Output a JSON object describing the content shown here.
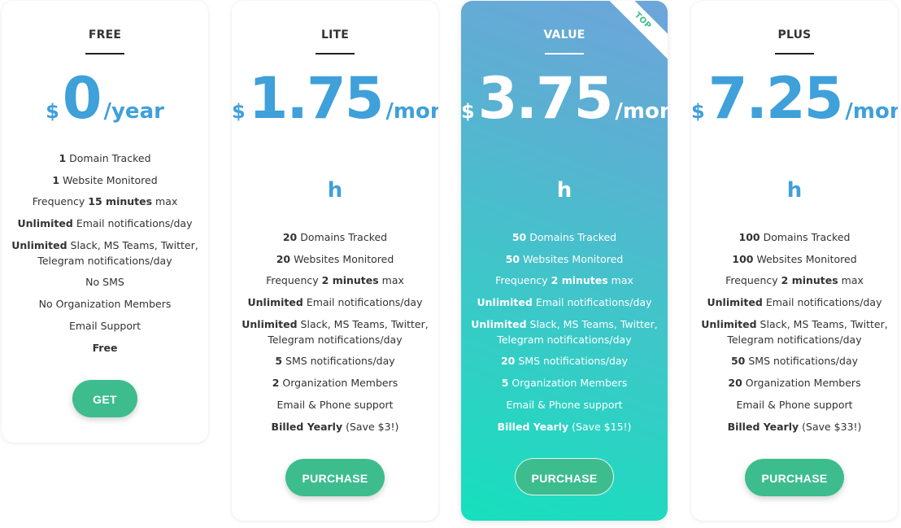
{
  "plans": [
    {
      "name": "FREE",
      "currency": "$",
      "amount": "0",
      "period": "/year",
      "period_wrap": "",
      "features": [
        {
          "bold": "1",
          "text": " Domain Tracked"
        },
        {
          "bold": "1",
          "text": " Website Monitored"
        },
        {
          "pre": "Frequency ",
          "bold": "15 minutes",
          "text": " max"
        },
        {
          "bold": "Unlimited",
          "text": " Email notifications/day"
        },
        {
          "bold": "Unlimited",
          "text": " Slack, MS Teams, Twitter, Telegram notifications/day"
        },
        {
          "bold": "",
          "text": "No SMS"
        },
        {
          "bold": "",
          "text": "No Organization Members"
        },
        {
          "bold": "",
          "text": "Email Support"
        },
        {
          "bold": "Free",
          "text": ""
        }
      ],
      "button": "GET"
    },
    {
      "name": "LITE",
      "currency": "$",
      "amount": "1.75",
      "period": "/mont",
      "period_wrap": "h",
      "features": [
        {
          "bold": "20",
          "text": " Domains Tracked"
        },
        {
          "bold": "20",
          "text": " Websites Monitored"
        },
        {
          "pre": "Frequency ",
          "bold": "2 minutes",
          "text": " max"
        },
        {
          "bold": "Unlimited",
          "text": " Email notifications/day"
        },
        {
          "bold": "Unlimited",
          "text": " Slack, MS Teams, Twitter, Telegram notifications/day"
        },
        {
          "bold": "5",
          "text": " SMS notifications/day"
        },
        {
          "bold": "2",
          "text": " Organization Members"
        },
        {
          "bold": "",
          "text": "Email & Phone support"
        },
        {
          "bold": "Billed Yearly",
          "text": " (Save $3!)"
        }
      ],
      "button": "PURCHASE"
    },
    {
      "name": "VALUE",
      "currency": "$",
      "amount": "3.75",
      "period": "/mont",
      "period_wrap": "h",
      "ribbon": "TOP",
      "features": [
        {
          "bold": "50",
          "text": " Domains Tracked"
        },
        {
          "bold": "50",
          "text": " Websites Monitored"
        },
        {
          "pre": "Frequency ",
          "bold": "2 minutes",
          "text": " max"
        },
        {
          "bold": "Unlimited",
          "text": " Email notifications/day"
        },
        {
          "bold": "Unlimited",
          "text": " Slack, MS Teams, Twitter, Telegram notifications/day"
        },
        {
          "bold": "20",
          "text": " SMS notifications/day"
        },
        {
          "bold": "5",
          "text": " Organization Members"
        },
        {
          "bold": "",
          "text": "Email & Phone support"
        },
        {
          "bold": "Billed Yearly",
          "text": " (Save $15!)"
        }
      ],
      "button": "PURCHASE"
    },
    {
      "name": "PLUS",
      "currency": "$",
      "amount": "7.25",
      "period": "/mont",
      "period_wrap": "h",
      "features": [
        {
          "bold": "100",
          "text": " Domains Tracked"
        },
        {
          "bold": "100",
          "text": " Websites Monitored"
        },
        {
          "pre": "Frequency ",
          "bold": "2 minutes",
          "text": " max"
        },
        {
          "bold": "Unlimited",
          "text": " Email notifications/day"
        },
        {
          "bold": "Unlimited",
          "text": " Slack, MS Teams, Twitter, Telegram notifications/day"
        },
        {
          "bold": "50",
          "text": " SMS notifications/day"
        },
        {
          "bold": "20",
          "text": " Organization Members"
        },
        {
          "bold": "",
          "text": "Email & Phone support"
        },
        {
          "bold": "Billed Yearly",
          "text": " (Save $33!)"
        }
      ],
      "button": "PURCHASE"
    }
  ],
  "colors": {
    "price_blue": "#3fa0da",
    "button_green": "#3dbd8d",
    "highlight_gradient_start": "#16e0bd",
    "highlight_gradient_end": "#6ea5db"
  }
}
